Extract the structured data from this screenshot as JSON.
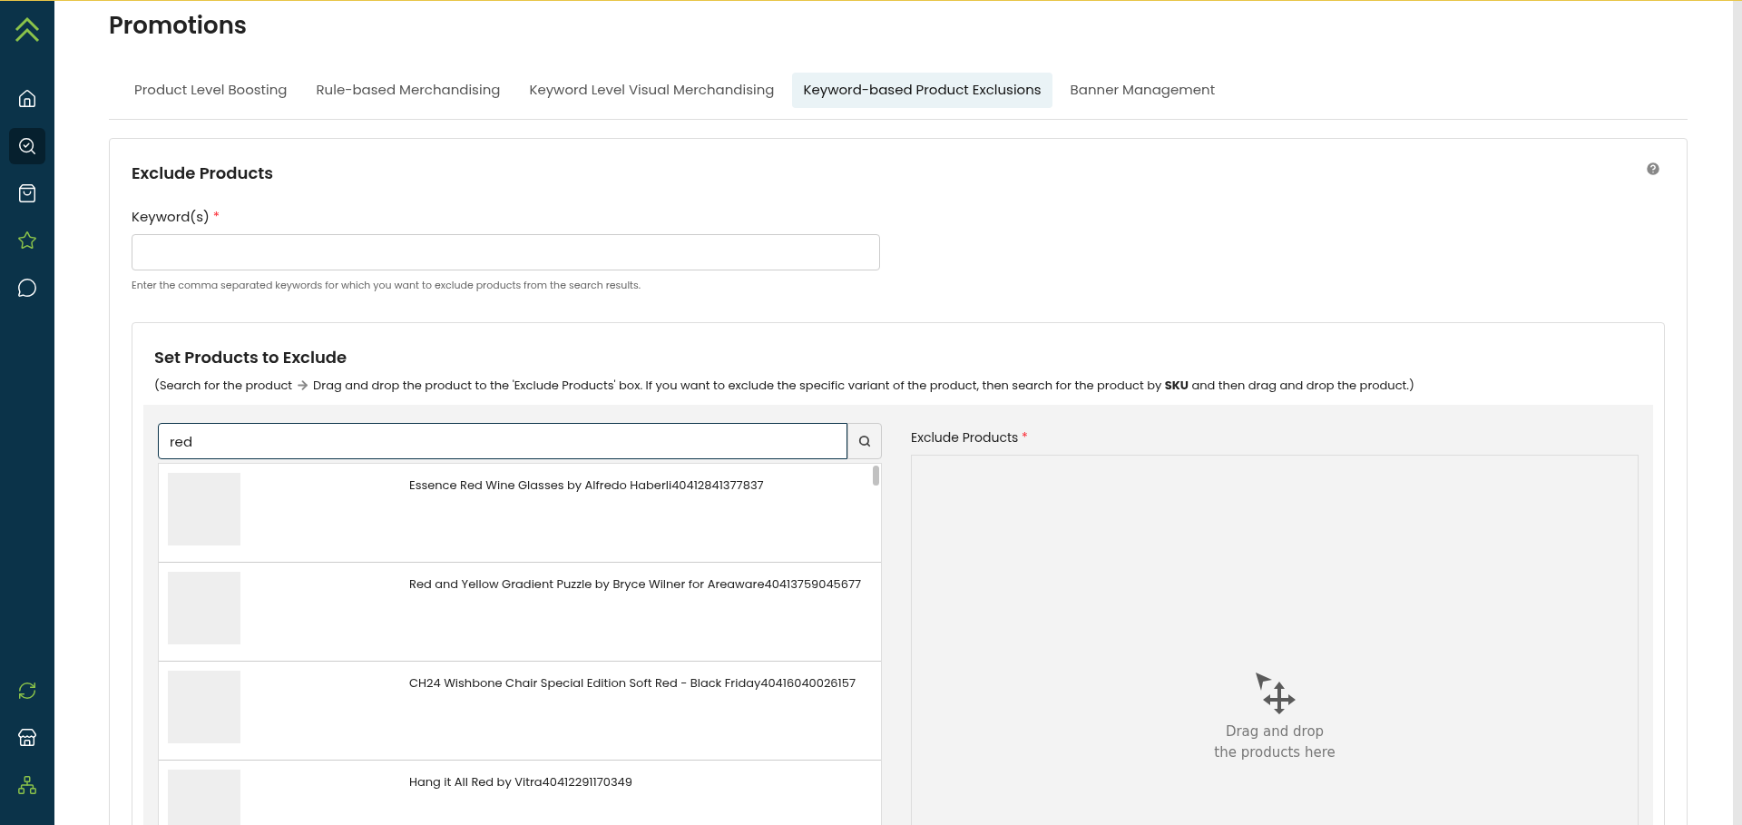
{
  "sidebar": {
    "items": [
      {
        "kind": "home",
        "selected": false
      },
      {
        "kind": "search",
        "selected": true
      },
      {
        "kind": "bag",
        "selected": false
      },
      {
        "kind": "stars",
        "selected": false
      },
      {
        "kind": "chat",
        "selected": false
      }
    ],
    "bottom_items": [
      {
        "kind": "sync",
        "selected": false
      },
      {
        "kind": "store",
        "selected": false
      },
      {
        "kind": "tree",
        "selected": false
      }
    ]
  },
  "page": {
    "title": "Promotions"
  },
  "tabs": [
    {
      "label": "Product Level Boosting",
      "selected": false
    },
    {
      "label": "Rule-based Merchandising",
      "selected": false
    },
    {
      "label": "Keyword Level Visual Merchandising",
      "selected": false
    },
    {
      "label": "Keyword-based Product Exclusions",
      "selected": true
    },
    {
      "label": "Banner Management",
      "selected": false
    }
  ],
  "form": {
    "title": "Exclude Products",
    "keyword_label": "Keyword(s)",
    "required_mark": "*",
    "keyword_help": "Enter the comma separated keywords for which you want to exclude products from the search results."
  },
  "set_products": {
    "title": "Set Products to Exclude",
    "desc_before": "(Search for the product",
    "desc_after": "Drag and drop the product to the 'Exclude Products' box. If you want to exclude the specific variant of the product, then search for the product by **SKU** and then drag and drop the product.)",
    "search_value": "red",
    "results": [
      {
        "name": "Essence Red Wine Glasses by Alfredo Haberli40412841377837"
      },
      {
        "name": "Red and Yellow Gradient Puzzle by Bryce Wilner for Areaware40413759045677"
      },
      {
        "name": "CH24 Wishbone Chair Special Edition Soft Red - Black Friday40416040026157"
      },
      {
        "name": "Hang it All Red by Vitra40412291170349"
      }
    ],
    "exclude_label": "Exclude Products",
    "required_mark": "*",
    "drop_line1": "Drag and drop",
    "drop_line2": "the products here"
  }
}
